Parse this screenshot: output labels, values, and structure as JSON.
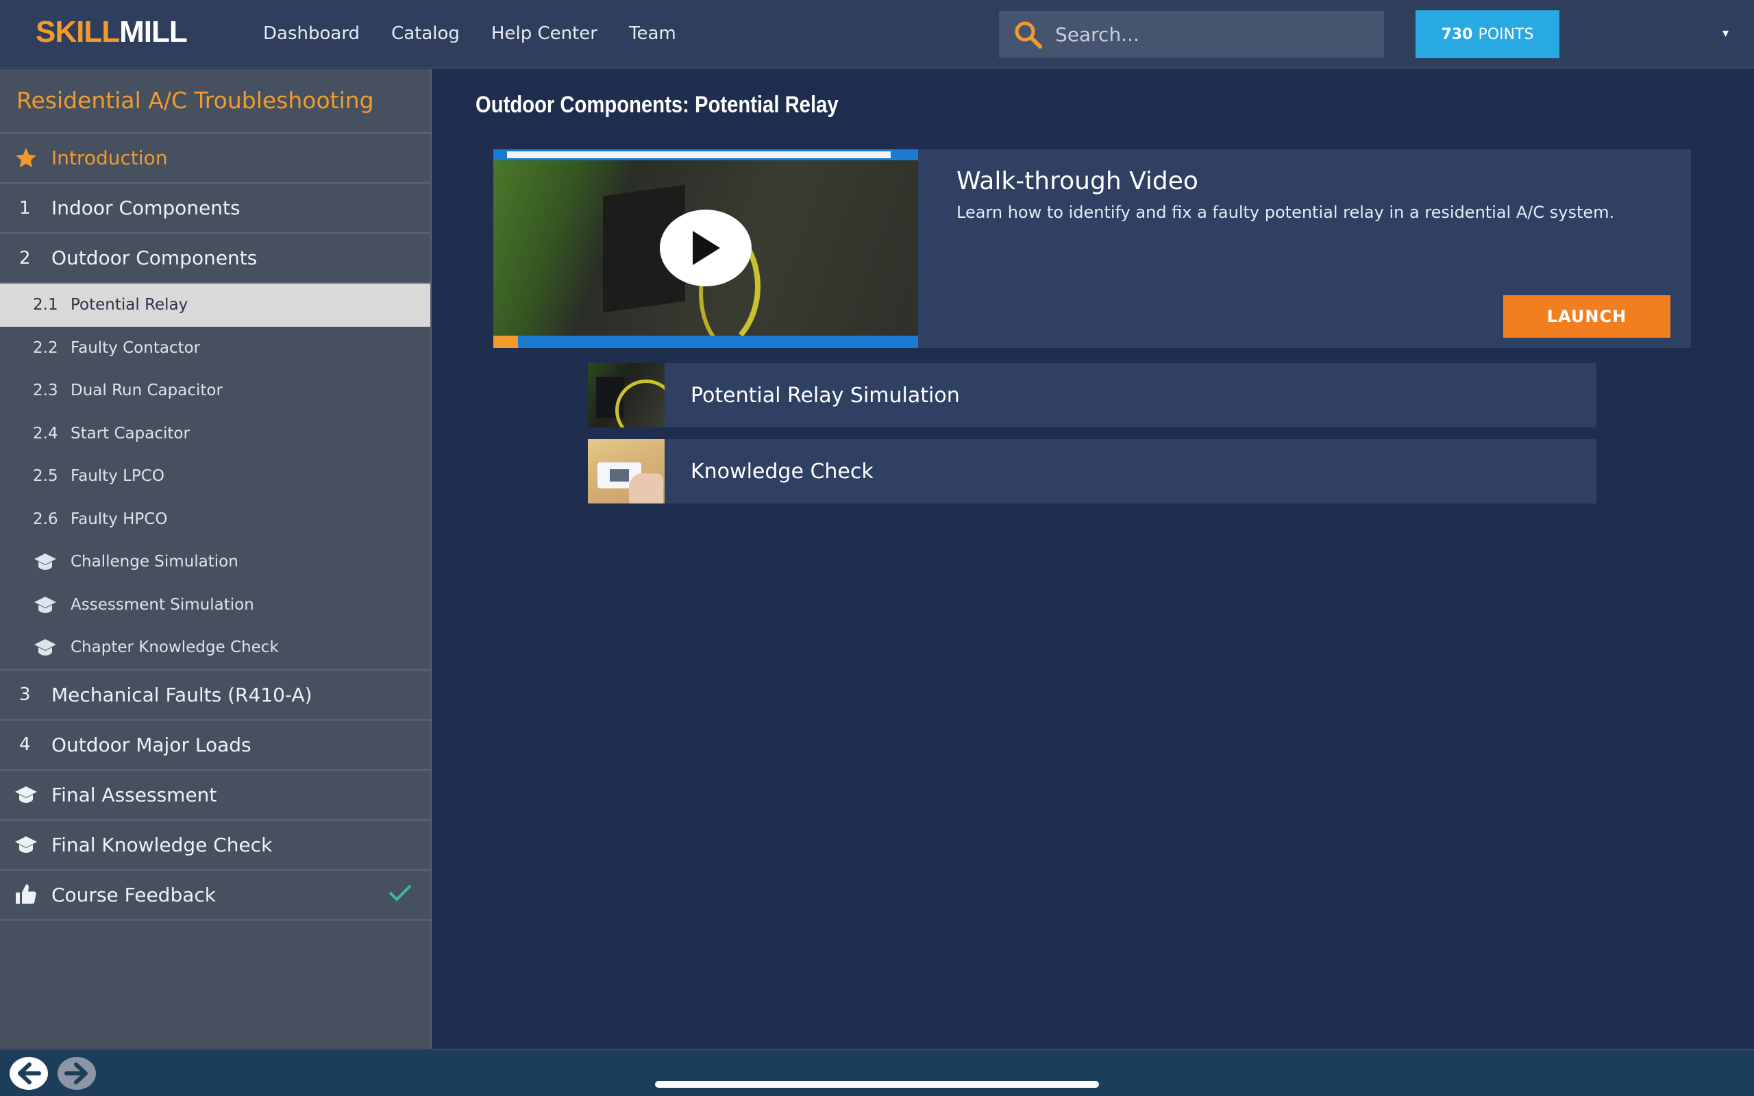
{
  "header": {
    "logo_part1": "SKILL",
    "logo_part2": "MILL",
    "nav": [
      "Dashboard",
      "Catalog",
      "Help Center",
      "Team"
    ],
    "search_placeholder": "Search...",
    "points_value": "730",
    "points_label": "POINTS",
    "caret": "▾"
  },
  "sidebar": {
    "course_title": "Residential A/C Troubleshooting",
    "intro": "Introduction",
    "chapters": [
      {
        "num": "1",
        "label": "Indoor Components"
      },
      {
        "num": "2",
        "label": "Outdoor Components"
      }
    ],
    "sub_items": [
      {
        "num": "2.1",
        "label": "Potential Relay",
        "active": true
      },
      {
        "num": "2.2",
        "label": "Faulty Contactor"
      },
      {
        "num": "2.3",
        "label": "Dual Run Capacitor"
      },
      {
        "num": "2.4",
        "label": "Start Capacitor"
      },
      {
        "num": "2.5",
        "label": "Faulty LPCO"
      },
      {
        "num": "2.6",
        "label": "Faulty HPCO"
      }
    ],
    "sub_assessments": [
      "Challenge Simulation",
      "Assessment Simulation",
      "Chapter Knowledge Check"
    ],
    "chapters_after": [
      {
        "num": "3",
        "label": "Mechanical Faults (R410-A)"
      },
      {
        "num": "4",
        "label": "Outdoor Major Loads"
      }
    ],
    "final_assessment": "Final Assessment",
    "final_knowledge_check": "Final Knowledge Check",
    "course_feedback": "Course Feedback"
  },
  "main": {
    "page_title": "Outdoor Components: Potential Relay",
    "video": {
      "title": "Walk-through Video",
      "description": "Learn how to identify and fix a faulty potential relay in a residential A/C system.",
      "launch_label": "LAUNCH"
    },
    "activities": [
      "Potential Relay Simulation",
      "Knowledge Check"
    ]
  },
  "colors": {
    "accent_orange": "#f39a2d",
    "launch_orange": "#f27f1f",
    "points_blue": "#29a9e1",
    "check_green": "#3cb99a",
    "background": "#1f2d4e",
    "sidebar": "#46505f"
  },
  "icons": {
    "search": "search-icon",
    "intro": "star-icon",
    "assessment": "graduation-cap-icon",
    "feedback": "thumbs-up-icon",
    "complete": "checkmark-icon",
    "play": "play-icon",
    "back": "arrow-left-icon",
    "forward": "arrow-right-icon"
  }
}
